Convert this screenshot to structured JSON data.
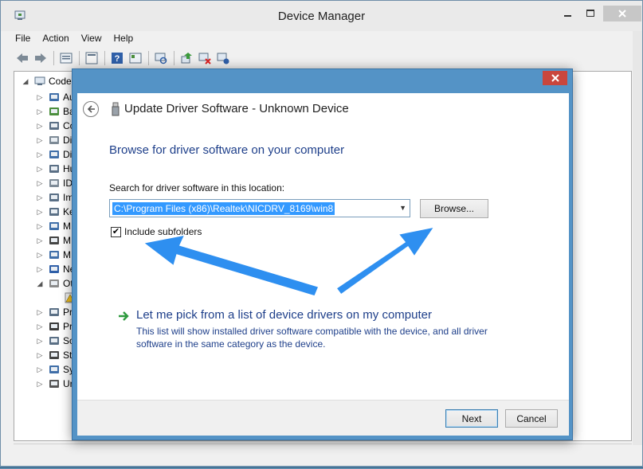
{
  "device_manager": {
    "title": "Device Manager",
    "menu": [
      "File",
      "Action",
      "View",
      "Help"
    ],
    "toolbar_icons": [
      "back-icon",
      "forward-icon",
      "properties-icon",
      "console-icon",
      "help-icon",
      "view-icon",
      "scan-icon",
      "update-driver-icon",
      "disable-icon",
      "uninstall-icon"
    ],
    "tree": {
      "root_label": "CodeL",
      "categories": [
        {
          "label": "Au",
          "icon": "audio-icon"
        },
        {
          "label": "Ba",
          "icon": "battery-icon"
        },
        {
          "label": "Co",
          "icon": "computer-icon"
        },
        {
          "label": "Di",
          "icon": "disk-icon"
        },
        {
          "label": "Di",
          "icon": "display-icon"
        },
        {
          "label": "Hu",
          "icon": "hid-icon"
        },
        {
          "label": "ID",
          "icon": "ide-icon"
        },
        {
          "label": "Im",
          "icon": "imaging-icon"
        },
        {
          "label": "Ke",
          "icon": "keyboard-icon"
        },
        {
          "label": "M",
          "icon": "memory-icon"
        },
        {
          "label": "M",
          "icon": "mouse-icon"
        },
        {
          "label": "M",
          "icon": "monitor-icon"
        },
        {
          "label": "Ne",
          "icon": "network-icon"
        },
        {
          "label": "Ot",
          "icon": "other-devices-icon"
        },
        {
          "label": "",
          "icon": "warning-device-icon"
        },
        {
          "label": "Pr",
          "icon": "printer-icon"
        },
        {
          "label": "Pr",
          "icon": "processor-icon"
        },
        {
          "label": "So",
          "icon": "sound-icon"
        },
        {
          "label": "St",
          "icon": "storage-icon"
        },
        {
          "label": "Sy",
          "icon": "system-icon"
        },
        {
          "label": "Ur",
          "icon": "usb-icon"
        }
      ]
    }
  },
  "dialog": {
    "title": "Update Driver Software - Unknown Device",
    "heading": "Browse for driver software on your computer",
    "search_label": "Search for driver software in this location:",
    "path_value": "C:\\Program Files (x86)\\Realtek\\NICDRV_8169\\win8",
    "browse_label": "Browse...",
    "include_subfolders_label": "Include subfolders",
    "include_subfolders_checked": true,
    "checkmark": "✔",
    "pick_title": "Let me pick from a list of device drivers on my computer",
    "pick_desc": "This list will show installed driver software compatible with the device, and all driver software in the same category as the device.",
    "next_label": "Next",
    "cancel_label": "Cancel"
  },
  "colors": {
    "heading_blue": "#1e3f8a",
    "dialog_frame": "#5493c6",
    "close_red": "#c9463d",
    "annotation_arrow": "#2e8ff0",
    "selection": "#3399ff"
  }
}
